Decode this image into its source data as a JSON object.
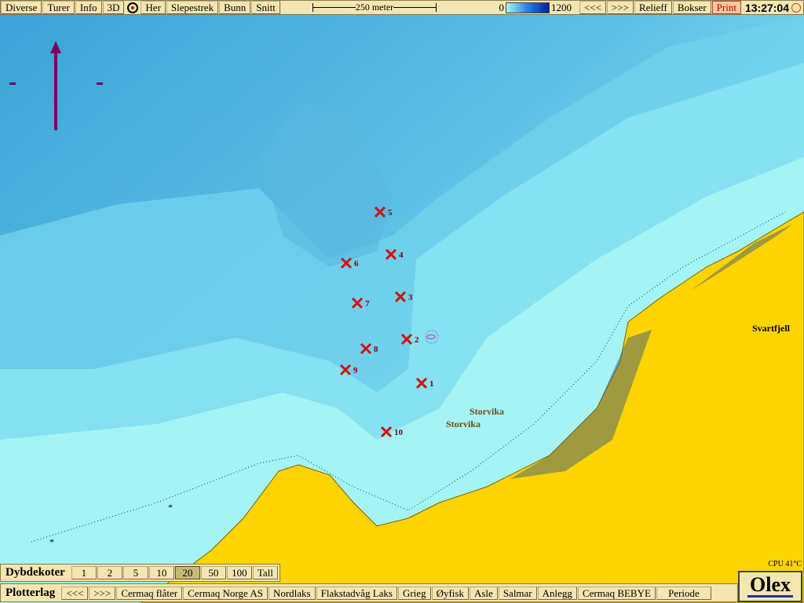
{
  "toolbar": {
    "items": [
      "Diverse",
      "Turer",
      "Info",
      "3D",
      "Her",
      "Slepestrek",
      "Bunn",
      "Snitt"
    ],
    "scale": "250 meter",
    "depth_min": "0",
    "depth_max": "1200",
    "prev": "<<<",
    "next": ">>>",
    "relief": "Relieff",
    "bokser": "Bokser",
    "print": "Print",
    "time": "13:27:04"
  },
  "map": {
    "places": [
      "Svartfjell",
      "Storvika",
      "Storvika"
    ],
    "markers": [
      "1",
      "2",
      "3",
      "4",
      "5",
      "6",
      "7",
      "8",
      "9",
      "10"
    ],
    "colors": {
      "deep": "#3fa6d8",
      "mid": "#6cc8e8",
      "shallow": "#9ef0f4",
      "land": "#fcd400",
      "marker": "#d01010"
    }
  },
  "dybdekoter": {
    "label": "Dybdekoter",
    "options": [
      "1",
      "2",
      "5",
      "10",
      "20",
      "50",
      "100",
      "Tall"
    ],
    "selected": "20"
  },
  "plotterlag": {
    "label": "Plotterlag",
    "items": [
      "<<<",
      ">>>",
      "Cermaq flåter",
      "Cermaq Norge AS",
      "Nordlaks",
      "Flakstadvåg Laks",
      "Grieg",
      "Øyfisk",
      "Asle",
      "Salmar",
      "Anlegg",
      "Cermaq BEBYE",
      "Periode"
    ]
  },
  "status": {
    "cpu": "CPU 41°C",
    "logo": "Olex"
  }
}
